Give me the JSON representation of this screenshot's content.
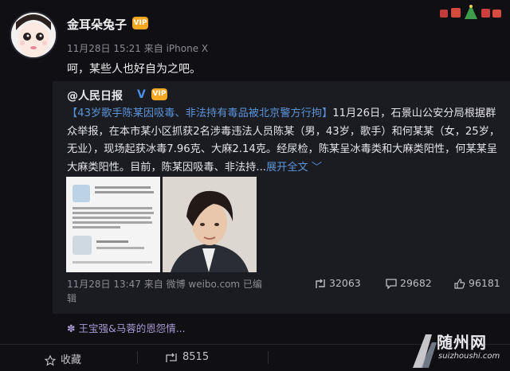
{
  "post": {
    "author": "金耳朵兔子",
    "vip_badge": "VIP",
    "meta": "11月28日 15:21 来自 iPhone X",
    "text": "呵，某些人也好自为之吧。"
  },
  "repost": {
    "author": "@人民日报",
    "verified": "V",
    "vip_badge": "VIP",
    "headline": "【43岁歌手陈某因吸毒、非法持有毒品被北京警方行拘】",
    "body": "11月26日，石景山公安分局根据群众举报，在本市某小区抓获2名涉毒违法人员陈某（男，43岁，歌手）和何某某（女，25岁，无业），现场起获冰毒7.96克、大麻2.14克。经尿检，陈某呈冰毒类和大麻类阳性，何某某呈大麻类阳性。目前，陈某因吸毒、非法持...",
    "expand": "展开全文 ﹀",
    "meta_line1": "11月28日 13:47 来自 微博 weibo.com 已编",
    "meta_line2": "辑",
    "reposts": "32063",
    "comments": "29682",
    "likes": "96181"
  },
  "topic": "王宝强&马蓉的恩怨情...",
  "bottom": {
    "favorite": "收藏",
    "repost_count": "8515"
  },
  "watermark": {
    "title": "随州网",
    "sub": "suizhoushi.com"
  },
  "colors": {
    "background": "#101014",
    "repost_panel": "#1b1b22",
    "link": "#5b94d8",
    "topic": "#a79ad4",
    "vip": "#f5a623"
  }
}
